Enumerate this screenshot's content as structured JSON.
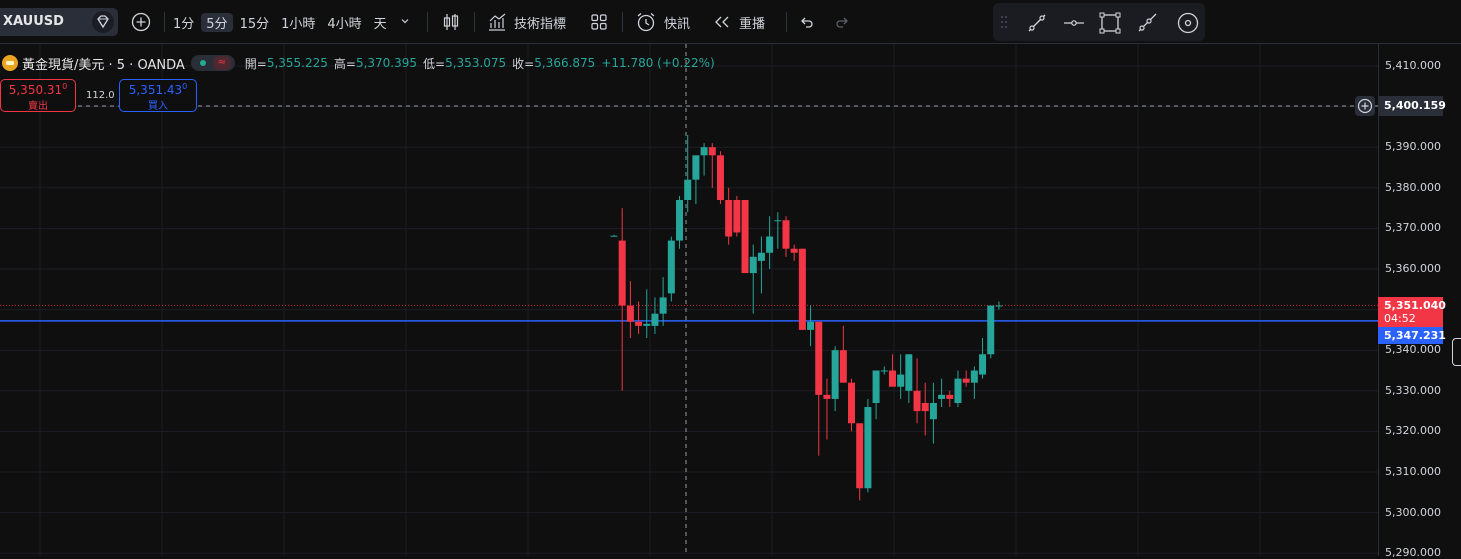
{
  "toolbar": {
    "symbol": "XAUUSD",
    "intervals": [
      "1分",
      "5分",
      "15分",
      "1小時",
      "4小時",
      "天"
    ],
    "active_interval": "5分",
    "indicators_label": "技術指標",
    "alert_label": "快訊",
    "replay_label": "重播"
  },
  "legend": {
    "title": "黃金現貨/美元 · 5 · OANDA",
    "market_icon": "≈",
    "open_label": "開=",
    "open_value": "5,355.225",
    "high_label": "高=",
    "high_value": "5,370.395",
    "low_label": "低=",
    "low_value": "5,353.075",
    "close_label": "收=",
    "close_value": "5,366.875",
    "change": "+11.780 (+0.22%)"
  },
  "trade": {
    "sell_price": "5,350.31",
    "sell_price_sup": "0",
    "sell_label": "賣出",
    "spread": "112.0",
    "buy_price": "5,351.43",
    "buy_price_sup": "0",
    "buy_label": "買入"
  },
  "price_axis": {
    "ticks": [
      "5,410.000",
      "5,400.000",
      "5,390.000",
      "5,380.000",
      "5,370.000",
      "5,360.000",
      "5,350.000",
      "5,340.000",
      "5,330.000",
      "5,320.000",
      "5,310.000",
      "5,300.000",
      "5,290.000"
    ],
    "alert_price": "5,400.159",
    "last_price": "5,351.040",
    "countdown": "04:52",
    "blue_line_price": "5,347.231"
  },
  "chart_data": {
    "type": "candlestick",
    "symbol": "XAUUSD",
    "interval": "5m",
    "ylim": [
      5290,
      5412
    ],
    "up_color": "#26a69a",
    "down_color": "#f23645",
    "horizontal_lines": [
      {
        "price": 5400.159,
        "style": "dashed",
        "color": "#9598a1"
      },
      {
        "price": 5347.231,
        "style": "solid",
        "color": "#2962ff"
      },
      {
        "price": 5351.04,
        "style": "dotted",
        "color": "#f23645"
      }
    ],
    "candles": [
      {
        "o": 5368.2,
        "h": 5368.4,
        "l": 5368.0,
        "c": 5368.2
      },
      {
        "o": 5367.0,
        "h": 5375.0,
        "l": 5330.0,
        "c": 5351.0
      },
      {
        "o": 5351.0,
        "h": 5357.0,
        "l": 5343.0,
        "c": 5347.0
      },
      {
        "o": 5347.0,
        "h": 5352.0,
        "l": 5344.0,
        "c": 5346.0
      },
      {
        "o": 5346.0,
        "h": 5355.0,
        "l": 5343.0,
        "c": 5346.5
      },
      {
        "o": 5346.0,
        "h": 5353.0,
        "l": 5344.0,
        "c": 5349.0
      },
      {
        "o": 5349.0,
        "h": 5358.0,
        "l": 5346.0,
        "c": 5353.0
      },
      {
        "o": 5354.0,
        "h": 5368.0,
        "l": 5352.0,
        "c": 5367.0
      },
      {
        "o": 5367.0,
        "h": 5378.0,
        "l": 5365.0,
        "c": 5377.0
      },
      {
        "o": 5377.0,
        "h": 5393.0,
        "l": 5374.0,
        "c": 5382.0
      },
      {
        "o": 5382.0,
        "h": 5388.0,
        "l": 5376.0,
        "c": 5388.0
      },
      {
        "o": 5388.0,
        "h": 5391.0,
        "l": 5383.0,
        "c": 5390.0
      },
      {
        "o": 5390.0,
        "h": 5391.0,
        "l": 5380.0,
        "c": 5388.0
      },
      {
        "o": 5388.0,
        "h": 5389.0,
        "l": 5376.0,
        "c": 5377.0
      },
      {
        "o": 5377.0,
        "h": 5380.0,
        "l": 5366.0,
        "c": 5368.0
      },
      {
        "o": 5377.0,
        "h": 5378.0,
        "l": 5368.0,
        "c": 5369.0
      },
      {
        "o": 5377.0,
        "h": 5377.0,
        "l": 5359.0,
        "c": 5359.0
      },
      {
        "o": 5359.0,
        "h": 5366.0,
        "l": 5349.0,
        "c": 5363.0
      },
      {
        "o": 5362.0,
        "h": 5368.0,
        "l": 5354.0,
        "c": 5364.0
      },
      {
        "o": 5364.0,
        "h": 5373.0,
        "l": 5360.0,
        "c": 5368.0
      },
      {
        "o": 5372.0,
        "h": 5374.0,
        "l": 5365.0,
        "c": 5372.0
      },
      {
        "o": 5372.0,
        "h": 5373.0,
        "l": 5363.0,
        "c": 5365.0
      },
      {
        "o": 5365.0,
        "h": 5366.0,
        "l": 5362.0,
        "c": 5364.0
      },
      {
        "o": 5365.0,
        "h": 5365.0,
        "l": 5345.0,
        "c": 5345.0
      },
      {
        "o": 5345.0,
        "h": 5351.0,
        "l": 5341.0,
        "c": 5347.0
      },
      {
        "o": 5347.0,
        "h": 5347.0,
        "l": 5314.0,
        "c": 5329.0
      },
      {
        "o": 5329.0,
        "h": 5333.0,
        "l": 5318.0,
        "c": 5328.0
      },
      {
        "o": 5328.0,
        "h": 5341.0,
        "l": 5325.0,
        "c": 5340.0
      },
      {
        "o": 5340.0,
        "h": 5346.0,
        "l": 5332.0,
        "c": 5332.0
      },
      {
        "o": 5332.0,
        "h": 5333.0,
        "l": 5320.0,
        "c": 5322.0
      },
      {
        "o": 5322.0,
        "h": 5322.0,
        "l": 5303.0,
        "c": 5306.0
      },
      {
        "o": 5306.0,
        "h": 5328.0,
        "l": 5305.0,
        "c": 5326.0
      },
      {
        "o": 5327.0,
        "h": 5335.0,
        "l": 5323.0,
        "c": 5335.0
      },
      {
        "o": 5335.0,
        "h": 5336.0,
        "l": 5334.0,
        "c": 5335.0
      },
      {
        "o": 5335.0,
        "h": 5339.0,
        "l": 5332.0,
        "c": 5331.0
      },
      {
        "o": 5331.0,
        "h": 5339.0,
        "l": 5328.0,
        "c": 5334.0
      },
      {
        "o": 5330.0,
        "h": 5339.0,
        "l": 5327.0,
        "c": 5339.0
      },
      {
        "o": 5330.0,
        "h": 5338.0,
        "l": 5322.0,
        "c": 5325.0
      },
      {
        "o": 5327.0,
        "h": 5332.0,
        "l": 5319.0,
        "c": 5325.0
      },
      {
        "o": 5323.0,
        "h": 5332.0,
        "l": 5317.0,
        "c": 5327.0
      },
      {
        "o": 5328.0,
        "h": 5333.0,
        "l": 5326.0,
        "c": 5329.0
      },
      {
        "o": 5329.0,
        "h": 5330.0,
        "l": 5326.0,
        "c": 5328.0
      },
      {
        "o": 5327.0,
        "h": 5335.0,
        "l": 5326.0,
        "c": 5333.0
      },
      {
        "o": 5333.0,
        "h": 5335.0,
        "l": 5331.0,
        "c": 5332.0
      },
      {
        "o": 5332.0,
        "h": 5336.0,
        "l": 5328.0,
        "c": 5335.0
      },
      {
        "o": 5334.0,
        "h": 5343.0,
        "l": 5333.0,
        "c": 5339.0
      },
      {
        "o": 5339.0,
        "h": 5344.0,
        "l": 5338.0,
        "c": 5351.0
      },
      {
        "o": 5351.0,
        "h": 5352.0,
        "l": 5350.0,
        "c": 5351.0
      }
    ]
  }
}
